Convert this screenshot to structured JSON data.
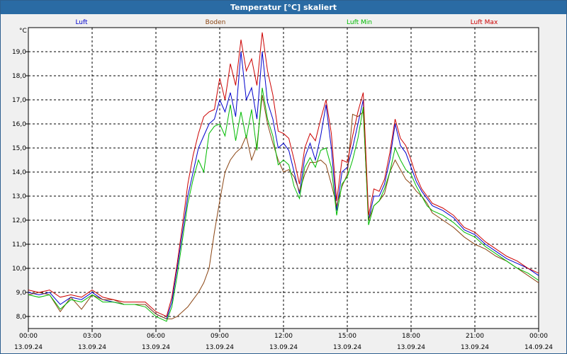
{
  "window": {
    "title": "Temperatur [°C] skaliert"
  },
  "colors": {
    "luft": "#0000cc",
    "boden": "#8b4513",
    "luft_min": "#00bb00",
    "luft_max": "#cc0000",
    "grid": "#000000",
    "background": "#ffffff"
  },
  "chart_data": {
    "type": "line",
    "title": "Temperatur [°C] skaliert",
    "ylabel": "°C",
    "ylim": [
      7.5,
      20.0
    ],
    "xlim": [
      "00:00",
      "24:00"
    ],
    "yticks": [
      "8,0",
      "9,0",
      "10,0",
      "11,0",
      "12,0",
      "13,0",
      "14,0",
      "15,0",
      "16,0",
      "17,0",
      "18,0",
      "19,0"
    ],
    "xticks": [
      {
        "time": "00:00",
        "date": "13.09.24"
      },
      {
        "time": "03:00",
        "date": "13.09.24"
      },
      {
        "time": "06:00",
        "date": "13.09.24"
      },
      {
        "time": "09:00",
        "date": "13.09.24"
      },
      {
        "time": "12:00",
        "date": "13.09.24"
      },
      {
        "time": "15:00",
        "date": "13.09.24"
      },
      {
        "time": "18:00",
        "date": "13.09.24"
      },
      {
        "time": "21:00",
        "date": "13.09.24"
      },
      {
        "time": "00:00",
        "date": "14.09.24"
      }
    ],
    "grid": true,
    "legend_position": "top",
    "x": [
      0,
      0.5,
      1,
      1.5,
      2,
      2.5,
      3,
      3.5,
      4,
      4.5,
      5,
      5.5,
      6,
      6.25,
      6.5,
      6.75,
      7,
      7.25,
      7.5,
      7.75,
      8,
      8.25,
      8.5,
      8.75,
      9,
      9.25,
      9.5,
      9.75,
      10,
      10.25,
      10.5,
      10.75,
      11,
      11.25,
      11.5,
      11.75,
      12,
      12.25,
      12.5,
      12.75,
      13,
      13.25,
      13.5,
      13.75,
      14,
      14.25,
      14.5,
      14.75,
      15,
      15.25,
      15.5,
      15.75,
      16,
      16.25,
      16.5,
      16.75,
      17,
      17.25,
      17.5,
      17.75,
      18,
      18.25,
      18.5,
      18.75,
      19,
      19.5,
      20,
      20.5,
      21,
      21.5,
      22,
      22.5,
      23,
      23.5,
      24
    ],
    "series": [
      {
        "name": "Luft",
        "color": "#0000cc",
        "values": [
          9.0,
          8.9,
          9.0,
          8.5,
          8.8,
          8.7,
          9.0,
          8.7,
          8.6,
          8.5,
          8.5,
          8.5,
          8.1,
          8.0,
          7.9,
          8.6,
          10.0,
          11.5,
          13.0,
          14.0,
          15.0,
          15.5,
          16.0,
          16.2,
          17.0,
          16.5,
          17.3,
          16.3,
          19.0,
          17.0,
          17.5,
          16.2,
          19.0,
          16.9,
          16.2,
          15.0,
          15.2,
          14.9,
          14.0,
          13.1,
          14.6,
          15.2,
          14.5,
          15.5,
          16.8,
          15.0,
          12.4,
          14.0,
          14.2,
          15.0,
          16.0,
          17.0,
          12.0,
          13.0,
          13.0,
          13.5,
          14.5,
          16.0,
          15.1,
          14.8,
          14.2,
          13.6,
          13.2,
          12.9,
          12.6,
          12.4,
          12.1,
          11.6,
          11.4,
          11.0,
          10.7,
          10.4,
          10.2,
          10.0,
          9.7
        ]
      },
      {
        "name": "Boden",
        "color": "#8b4513",
        "values": [
          8.9,
          9.0,
          8.9,
          8.2,
          8.8,
          8.3,
          8.9,
          8.7,
          8.7,
          8.5,
          8.5,
          8.5,
          8.1,
          8.0,
          7.9,
          7.9,
          8.0,
          8.2,
          8.4,
          8.7,
          9.0,
          9.4,
          10.0,
          11.5,
          12.8,
          14.0,
          14.5,
          14.8,
          15.0,
          15.5,
          14.5,
          15.1,
          17.2,
          16.0,
          15.2,
          14.5,
          14.0,
          14.1,
          13.8,
          13.2,
          13.9,
          14.4,
          14.4,
          14.5,
          14.3,
          13.5,
          12.6,
          13.4,
          13.9,
          16.4,
          16.3,
          16.5,
          12.0,
          12.6,
          12.8,
          13.1,
          14.0,
          14.5,
          14.1,
          13.7,
          13.5,
          13.2,
          13.0,
          12.7,
          12.3,
          12.0,
          11.7,
          11.3,
          11.0,
          10.8,
          10.5,
          10.3,
          10.0,
          9.7,
          9.4
        ]
      },
      {
        "name": "Luft Min",
        "color": "#00bb00",
        "values": [
          8.9,
          8.8,
          8.9,
          8.3,
          8.7,
          8.6,
          8.9,
          8.6,
          8.6,
          8.5,
          8.5,
          8.4,
          8.0,
          7.9,
          7.8,
          8.4,
          9.7,
          11.2,
          12.7,
          13.7,
          14.5,
          14.0,
          15.6,
          15.9,
          16.0,
          15.5,
          16.8,
          15.3,
          16.5,
          15.4,
          16.6,
          14.9,
          17.5,
          16.2,
          15.5,
          14.3,
          14.5,
          14.3,
          13.4,
          12.9,
          14.2,
          14.6,
          14.2,
          14.9,
          15.0,
          14.2,
          12.2,
          13.5,
          13.8,
          14.5,
          15.4,
          16.7,
          11.8,
          12.6,
          12.8,
          13.3,
          14.0,
          15.0,
          14.5,
          14.1,
          13.9,
          13.4,
          13.0,
          12.6,
          12.4,
          12.2,
          11.9,
          11.5,
          11.3,
          10.9,
          10.6,
          10.3,
          10.0,
          9.8,
          9.5
        ]
      },
      {
        "name": "Luft Max",
        "color": "#cc0000",
        "values": [
          9.1,
          9.0,
          9.1,
          8.8,
          8.9,
          8.8,
          9.1,
          8.8,
          8.7,
          8.6,
          8.6,
          8.6,
          8.2,
          8.1,
          8.0,
          8.8,
          10.2,
          11.8,
          13.5,
          14.7,
          15.6,
          16.3,
          16.5,
          16.6,
          17.9,
          17.0,
          18.5,
          17.6,
          19.5,
          18.2,
          18.7,
          17.6,
          19.8,
          18.2,
          17.2,
          15.7,
          15.6,
          15.4,
          14.5,
          13.5,
          15.0,
          15.6,
          15.3,
          16.2,
          17.0,
          15.6,
          12.8,
          14.5,
          14.4,
          15.5,
          16.5,
          17.3,
          12.2,
          13.3,
          13.2,
          13.7,
          14.8,
          16.2,
          15.4,
          15.1,
          14.5,
          13.8,
          13.3,
          13.0,
          12.7,
          12.5,
          12.2,
          11.7,
          11.5,
          11.1,
          10.8,
          10.5,
          10.3,
          10.0,
          9.8
        ]
      }
    ]
  }
}
